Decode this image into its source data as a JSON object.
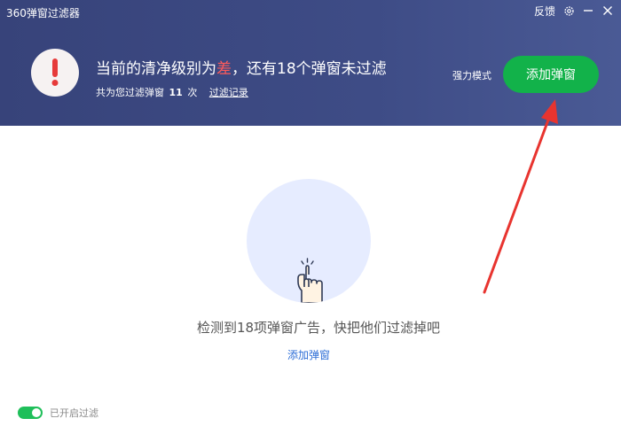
{
  "window": {
    "title": "360弹窗过滤器",
    "feedback_label": "反馈",
    "settings_icon": "gear-icon",
    "minimize_icon": "minimize-icon",
    "close_icon": "close-icon"
  },
  "status": {
    "icon": "exclamation-icon",
    "prefix": "当前的清净级别为",
    "level": "差",
    "suffix": "，还有18个弹窗未过滤",
    "sub_prefix": "共为您过滤弹窗",
    "filtered_count": "11",
    "sub_suffix": "次",
    "history_link": "过滤记录"
  },
  "actions": {
    "strong_mode_label": "强力模式",
    "add_button_label": "添加弹窗"
  },
  "main": {
    "illustration_icon": "pointing-hand-icon",
    "message": "检测到18项弹窗广告，快把他们过滤掉吧",
    "add_link": "添加弹窗"
  },
  "footer": {
    "toggle_on": true,
    "toggle_label": "已开启过滤"
  },
  "colors": {
    "header_bg": "#3e4c86",
    "accent_green": "#12b24a",
    "warning_red": "#ff5b5b",
    "link_blue": "#2f6fd7",
    "annotation_arrow": "#e8342f"
  }
}
